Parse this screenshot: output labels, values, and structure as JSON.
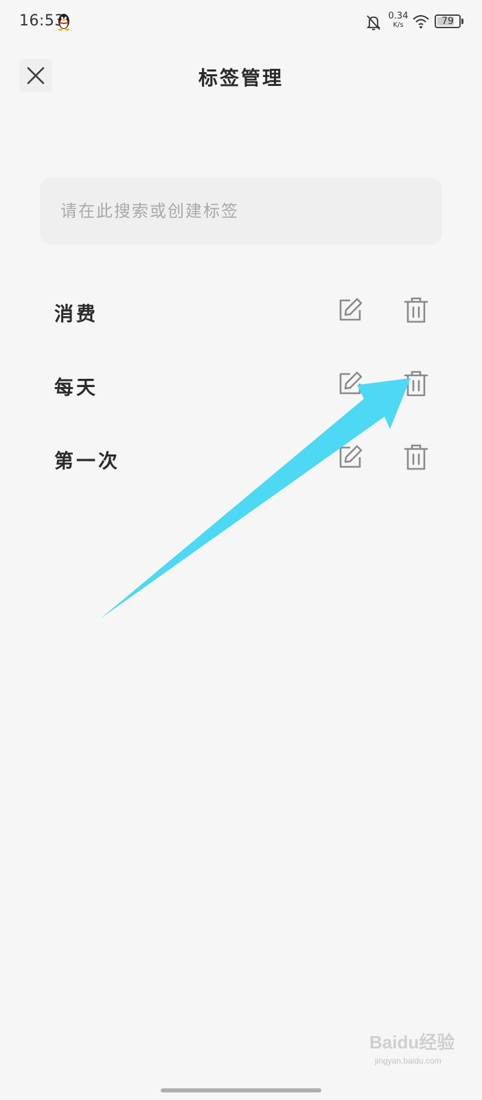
{
  "status_bar": {
    "time": "16:53",
    "net_speed_value": "0.34",
    "net_speed_unit": "K/s",
    "battery_level": "79",
    "battery_fraction": 0.79
  },
  "header": {
    "title": "标签管理",
    "close_icon": "close-icon"
  },
  "search": {
    "placeholder": "请在此搜索或创建标签"
  },
  "tags": [
    {
      "label": "消费"
    },
    {
      "label": "每天"
    },
    {
      "label": "第一次"
    }
  ],
  "icons": {
    "edit": "edit-icon",
    "delete": "trash-icon"
  },
  "watermark": {
    "brand": "Baidu经验",
    "url": "jingyan.baidu.com"
  },
  "colors": {
    "background": "#f6f6f6",
    "icon_gray": "#8a8a8a",
    "arrow": "#4dd8f4"
  }
}
